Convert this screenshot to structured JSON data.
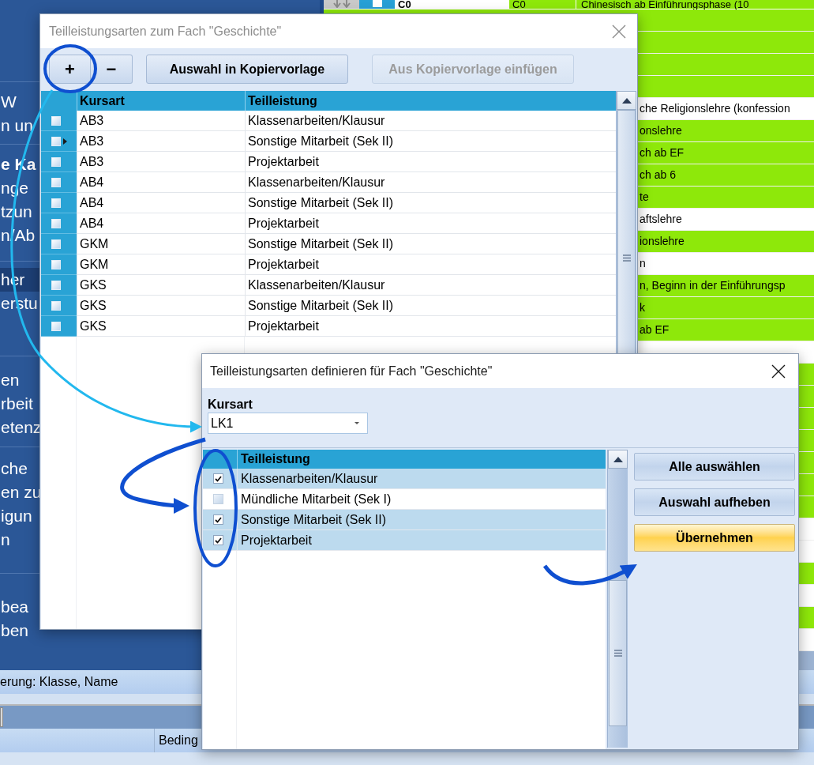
{
  "background": {
    "sidebar": {
      "groups": [
        {
          "lines": [
            {
              "text": "W",
              "bold": false,
              "selected": false
            },
            {
              "text": "n un",
              "bold": false,
              "selected": false
            }
          ]
        },
        {
          "lines": [
            {
              "text": "e Ka",
              "bold": true,
              "selected": false
            },
            {
              "text": "nge",
              "bold": false,
              "selected": false
            },
            {
              "text": "tzun",
              "bold": false,
              "selected": false
            },
            {
              "text": "n/Ab",
              "bold": false,
              "selected": false
            }
          ]
        },
        {
          "lines": [
            {
              "text": "her",
              "bold": false,
              "selected": true
            },
            {
              "text": "erstu",
              "bold": false,
              "selected": false
            }
          ]
        },
        {
          "lines": [
            {
              "text": "en",
              "bold": false,
              "selected": false
            },
            {
              "text": "rbeit",
              "bold": false,
              "selected": false
            },
            {
              "text": "etenz",
              "bold": false,
              "selected": false
            }
          ]
        },
        {
          "lines": [
            {
              "text": "che",
              "bold": false,
              "selected": false
            },
            {
              "text": "en zu",
              "bold": false,
              "selected": false
            },
            {
              "text": "igun",
              "bold": false,
              "selected": false
            },
            {
              "text": "n",
              "bold": false,
              "selected": false
            }
          ]
        },
        {
          "lines": [
            {
              "text": "bea",
              "bold": false,
              "selected": false
            },
            {
              "text": "ben",
              "bold": false,
              "selected": false
            }
          ]
        }
      ]
    },
    "grid": {
      "top_row": {
        "checked": false,
        "code": "C0",
        "code_2": "C0",
        "description": "Chinesisch ab Einführungsphase (10",
        "color": "#8ee80a"
      },
      "rows": [
        {
          "color": "#8ee80a"
        },
        {
          "color": "#8ee80a"
        },
        {
          "color": "#8ee80a"
        },
        {
          "color": "#8ee80a"
        },
        {
          "color": "#ffffff",
          "text": "che Religionslehre (konfession"
        },
        {
          "color": "#8ee80a",
          "text": "onslehre"
        },
        {
          "color": "#8ee80a",
          "text": "ch ab EF"
        },
        {
          "color": "#8ee80a",
          "text": "ch ab 6"
        },
        {
          "color": "#8ee80a",
          "text": "te"
        },
        {
          "color": "#ffffff",
          "text": "aftslehre"
        },
        {
          "color": "#8ee80a",
          "text": "ionslehre"
        },
        {
          "color": "#ffffff",
          "text": "n"
        },
        {
          "color": "#8ee80a",
          "text": "n, Beginn in der Einführungsp"
        },
        {
          "color": "#8ee80a",
          "text": "k"
        },
        {
          "color": "#8ee80a",
          "text": "ab EF"
        },
        {
          "color": "#ffffff"
        },
        {
          "color": "#8ee80a"
        },
        {
          "color": "#8ee80a"
        },
        {
          "color": "#8ee80a"
        },
        {
          "color": "#8ee80a"
        },
        {
          "color": "#8ee80a"
        },
        {
          "color": "#8ee80a"
        },
        {
          "color": "#8ee80a"
        },
        {
          "color": "#ffffff"
        },
        {
          "color": "#ffffff"
        },
        {
          "color": "#8ee80a"
        },
        {
          "color": "#ffffff"
        },
        {
          "color": "#8ee80a"
        },
        {
          "color": "#ffffff"
        }
      ]
    },
    "sort_bar": {
      "text": "erung: Klasse, Name"
    },
    "footer_bar": {
      "column_2": "Beding"
    }
  },
  "copy_dialog": {
    "title": "Teilleistungsarten zum Fach \"Geschichte\"",
    "toolbar": [
      {
        "label": "+",
        "kind": "small",
        "disabled": false
      },
      {
        "label": "−",
        "kind": "small",
        "disabled": false
      },
      {
        "label": "Auswahl in Kopiervorlage",
        "kind": "wide",
        "disabled": false
      },
      {
        "label": "Aus Kopiervorlage einfügen",
        "kind": "wide",
        "disabled": true
      }
    ],
    "columns": [
      "Kursart",
      "Teilleistung"
    ],
    "rows": [
      {
        "checked": false,
        "current": false,
        "cells": [
          "AB3",
          "Klassenarbeiten/Klausur"
        ]
      },
      {
        "checked": false,
        "current": true,
        "cells": [
          "AB3",
          "Sonstige Mitarbeit (Sek II)"
        ]
      },
      {
        "checked": false,
        "current": false,
        "cells": [
          "AB3",
          "Projektarbeit"
        ]
      },
      {
        "checked": false,
        "current": false,
        "cells": [
          "AB4",
          "Klassenarbeiten/Klausur"
        ]
      },
      {
        "checked": false,
        "current": false,
        "cells": [
          "AB4",
          "Sonstige Mitarbeit (Sek II)"
        ]
      },
      {
        "checked": false,
        "current": false,
        "cells": [
          "AB4",
          "Projektarbeit"
        ]
      },
      {
        "checked": false,
        "current": false,
        "cells": [
          "GKM",
          "Sonstige Mitarbeit (Sek II)"
        ]
      },
      {
        "checked": false,
        "current": false,
        "cells": [
          "GKM",
          "Projektarbeit"
        ]
      },
      {
        "checked": false,
        "current": false,
        "cells": [
          "GKS",
          "Klassenarbeiten/Klausur"
        ]
      },
      {
        "checked": false,
        "current": false,
        "cells": [
          "GKS",
          "Sonstige Mitarbeit (Sek II)"
        ]
      },
      {
        "checked": false,
        "current": false,
        "cells": [
          "GKS",
          "Projektarbeit"
        ]
      }
    ]
  },
  "define_dialog": {
    "title": "Teilleistungsarten definieren für Fach \"Geschichte\"",
    "kursart_label": "Kursart",
    "kursart_value": "LK1",
    "column": "Teilleistung",
    "rows": [
      {
        "checked": true,
        "label": "Klassenarbeiten/Klausur"
      },
      {
        "checked": false,
        "label": "Mündliche Mitarbeit (Sek I)"
      },
      {
        "checked": true,
        "label": "Sonstige Mitarbeit (Sek II)"
      },
      {
        "checked": true,
        "label": "Projektarbeit"
      }
    ],
    "buttons": [
      {
        "label": "Alle auswählen",
        "kind": "normal"
      },
      {
        "label": "Auswahl aufheben",
        "kind": "normal"
      },
      {
        "label": "Übernehmen",
        "kind": "primary"
      }
    ]
  }
}
